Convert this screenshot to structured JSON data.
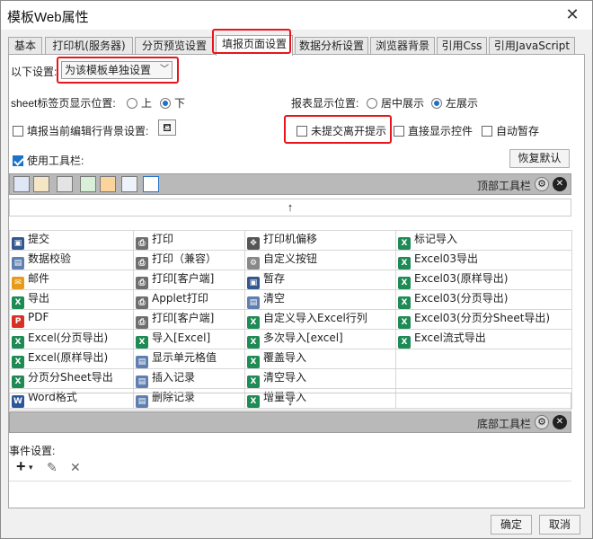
{
  "window": {
    "title": "模板Web属性",
    "close_glyph": "✕"
  },
  "tabs": [
    {
      "label": "基本"
    },
    {
      "label": "打印机(服务器)"
    },
    {
      "label": "分页预览设置"
    },
    {
      "label": "填报页面设置"
    },
    {
      "label": "数据分析设置"
    },
    {
      "label": "浏览器背景"
    },
    {
      "label": "引用Css"
    },
    {
      "label": "引用JavaScript"
    }
  ],
  "settings": {
    "following_label": "以下设置:",
    "mode_select": "为该模板单独设置",
    "sheet_position_label": "sheet标签页显示位置:",
    "sheet_top": "上",
    "sheet_bottom": "下",
    "report_position_label": "报表显示位置:",
    "report_center": "居中展示",
    "report_left": "左展示",
    "fill_bg_label": "填报当前编辑行背景设置:",
    "unsubmitted_prompt": "未提交离开提示",
    "direct_show_widget": "直接显示控件",
    "auto_save": "自动暂存",
    "use_toolbar": "使用工具栏:",
    "restore_default": "恢复默认"
  },
  "top_toolbar_label": "顶部工具栏",
  "bottom_toolbar_label": "底部工具栏",
  "up_arrow": "↑",
  "down_arrow": "↓",
  "grid": [
    [
      "提交",
      "打印",
      "打印机偏移",
      "标记导入"
    ],
    [
      "数据校验",
      "打印（兼容）",
      "自定义按钮",
      "Excel03导出"
    ],
    [
      "邮件",
      "打印[客户端]",
      "暂存",
      "Excel03(原样导出)"
    ],
    [
      "导出",
      "Applet打印",
      "清空",
      "Excel03(分页导出)"
    ],
    [
      "PDF",
      "打印[客户端]",
      "自定义导入Excel行列",
      "Excel03(分页分Sheet导出)"
    ],
    [
      "Excel(分页导出)",
      "导入[Excel]",
      "多次导入[excel]",
      "Excel流式导出"
    ],
    [
      "Excel(原样导出)",
      "显示单元格值",
      "覆盖导入",
      ""
    ],
    [
      "分页分Sheet导出",
      "插入记录",
      "清空导入",
      ""
    ],
    [
      "Word格式",
      "删除记录",
      "增量导入",
      ""
    ]
  ],
  "event": {
    "label": "事件设置:",
    "add": "+",
    "add_caret": "▾",
    "edit": "✎",
    "delete": "✕"
  },
  "footer": {
    "ok": "确定",
    "cancel": "取消"
  },
  "colors": {
    "highlight": "#e8161b",
    "accent": "#1a73c9",
    "excel_green": "#1e8a54",
    "pdf_red": "#d93025"
  }
}
